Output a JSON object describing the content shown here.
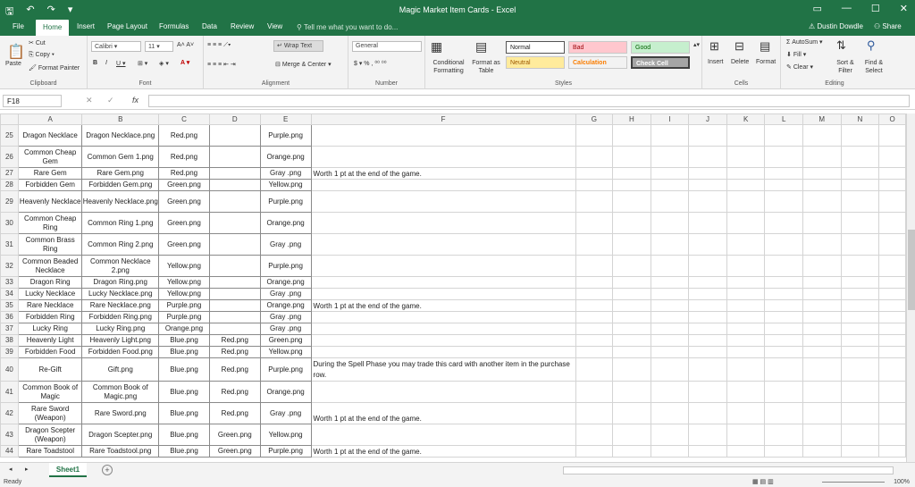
{
  "window": {
    "title": "Magic Market Item Cards - Excel",
    "user": "Dustin Dowdle",
    "share": "Share"
  },
  "tabs": [
    "File",
    "Home",
    "Insert",
    "Page Layout",
    "Formulas",
    "Data",
    "Review",
    "View"
  ],
  "tellme": "Tell me what you want to do...",
  "ribbon": {
    "clipboard": {
      "paste": "Paste",
      "cut": "Cut",
      "copy": "Copy",
      "painter": "Format Painter",
      "label": "Clipboard"
    },
    "font": {
      "name": "Calibri",
      "size": "11",
      "label": "Font"
    },
    "alignment": {
      "wrap": "Wrap Text",
      "merge": "Merge & Center",
      "label": "Alignment"
    },
    "number": {
      "format": "General",
      "label": "Number"
    },
    "styles": {
      "conditional": "Conditional Formatting",
      "table": "Format as Table",
      "normal": "Normal",
      "bad": "Bad",
      "good": "Good",
      "neutral": "Neutral",
      "calculation": "Calculation",
      "check": "Check Cell",
      "label": "Styles"
    },
    "cells": {
      "insert": "Insert",
      "delete": "Delete",
      "format": "Format",
      "label": "Cells"
    },
    "editing": {
      "autosum": "AutoSum",
      "fill": "Fill",
      "clear": "Clear",
      "sort": "Sort & Filter",
      "find": "Find & Select",
      "label": "Editing"
    }
  },
  "formula": {
    "namebox": "F18",
    "fx": "fx",
    "value": ""
  },
  "columns": [
    "A",
    "B",
    "C",
    "D",
    "E",
    "F",
    "G",
    "H",
    "I",
    "J",
    "K",
    "L",
    "M",
    "N",
    "O"
  ],
  "rows": [
    {
      "n": "25",
      "a": "Dragon Necklace",
      "b": "Dragon Necklace.png",
      "c": "Red.png",
      "d": "",
      "e": "Purple.png",
      "f": ""
    },
    {
      "n": "26",
      "a": "Common Cheap Gem",
      "b": "Common Gem 1.png",
      "c": "Red.png",
      "d": "",
      "e": "Orange.png",
      "f": ""
    },
    {
      "n": "27",
      "a": "Rare Gem",
      "b": "Rare Gem.png",
      "c": "Red.png",
      "d": "",
      "e": "Gray .png",
      "f": "Worth 1 pt at the end of the game."
    },
    {
      "n": "28",
      "a": "Forbidden Gem",
      "b": "Forbidden Gem.png",
      "c": "Green.png",
      "d": "",
      "e": "Yellow.png",
      "f": ""
    },
    {
      "n": "29",
      "a": "Heavenly Necklace",
      "b": "Heavenly Necklace.png",
      "c": "Green.png",
      "d": "",
      "e": "Purple.png",
      "f": ""
    },
    {
      "n": "30",
      "a": "Common Cheap Ring",
      "b": "Common Ring 1.png",
      "c": "Green.png",
      "d": "",
      "e": "Orange.png",
      "f": ""
    },
    {
      "n": "31",
      "a": "Common Brass Ring",
      "b": "Common Ring 2.png",
      "c": "Green.png",
      "d": "",
      "e": "Gray .png",
      "f": ""
    },
    {
      "n": "32",
      "a": "Common Beaded Necklace",
      "b": "Common Necklace 2.png",
      "c": "Yellow.png",
      "d": "",
      "e": "Purple.png",
      "f": ""
    },
    {
      "n": "33",
      "a": "Dragon Ring",
      "b": "Dragon Ring.png",
      "c": "Yellow.png",
      "d": "",
      "e": "Orange.png",
      "f": ""
    },
    {
      "n": "34",
      "a": "Lucky Necklace",
      "b": "Lucky Necklace.png",
      "c": "Yellow.png",
      "d": "",
      "e": "Gray .png",
      "f": ""
    },
    {
      "n": "35",
      "a": "Rare Necklace",
      "b": "Rare Necklace.png",
      "c": "Purple.png",
      "d": "",
      "e": "Orange.png",
      "f": "Worth 1 pt at the end of the game."
    },
    {
      "n": "36",
      "a": "Forbidden Ring",
      "b": "Forbidden Ring.png",
      "c": "Purple.png",
      "d": "",
      "e": "Gray .png",
      "f": ""
    },
    {
      "n": "37",
      "a": "Lucky Ring",
      "b": "Lucky Ring.png",
      "c": "Orange.png",
      "d": "",
      "e": "Gray .png",
      "f": ""
    },
    {
      "n": "38",
      "a": "Heavenly Light",
      "b": "Heavenly Light.png",
      "c": "Blue.png",
      "d": "Red.png",
      "e": "Green.png",
      "f": ""
    },
    {
      "n": "39",
      "a": "Forbidden Food",
      "b": "Forbidden Food.png",
      "c": "Blue.png",
      "d": "Red.png",
      "e": "Yellow.png",
      "f": ""
    },
    {
      "n": "40",
      "a": "Re-Gift",
      "b": "Gift.png",
      "c": "Blue.png",
      "d": "Red.png",
      "e": "Purple.png",
      "f": "During the Spell Phase you may trade this card with another item in the purchase row."
    },
    {
      "n": "41",
      "a": "Common Book of Magic",
      "b": "Common Book of Magic.png",
      "c": "Blue.png",
      "d": "Red.png",
      "e": "Orange.png",
      "f": ""
    },
    {
      "n": "42",
      "a": "Rare Sword (Weapon)",
      "b": "Rare Sword.png",
      "c": "Blue.png",
      "d": "Red.png",
      "e": "Gray .png",
      "f": "Worth 1 pt at the end of the game."
    },
    {
      "n": "43",
      "a": "Dragon Scepter (Weapon)",
      "b": "Dragon Scepter.png",
      "c": "Blue.png",
      "d": "Green.png",
      "e": "Yellow.png",
      "f": ""
    },
    {
      "n": "44",
      "a": "Rare Toadstool",
      "b": "Rare Toadstool.png",
      "c": "Blue.png",
      "d": "Green.png",
      "e": "Purple.png",
      "f": "Worth 1 pt at the end of the game."
    }
  ],
  "sheet": {
    "name": "Sheet1",
    "add": "+"
  },
  "status": {
    "ready": "Ready",
    "zoom": "100%"
  },
  "colors": {
    "accent": "#217346"
  }
}
